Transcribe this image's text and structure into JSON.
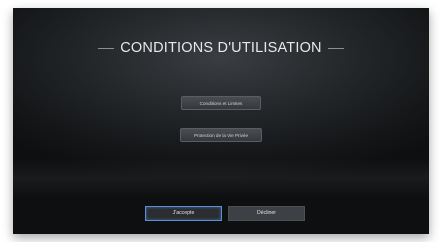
{
  "dialog": {
    "title": "CONDITIONS D'UTILISATION",
    "links": [
      {
        "label": "Conditions et Limites"
      },
      {
        "label": "Protection de la Vie Privée"
      }
    ],
    "accept_label": "J'accepte",
    "decline_label": "Décliner"
  },
  "colors": {
    "background": "#1e2124",
    "title_text": "#e7e8ea",
    "focus_border": "#5b8fd6"
  }
}
